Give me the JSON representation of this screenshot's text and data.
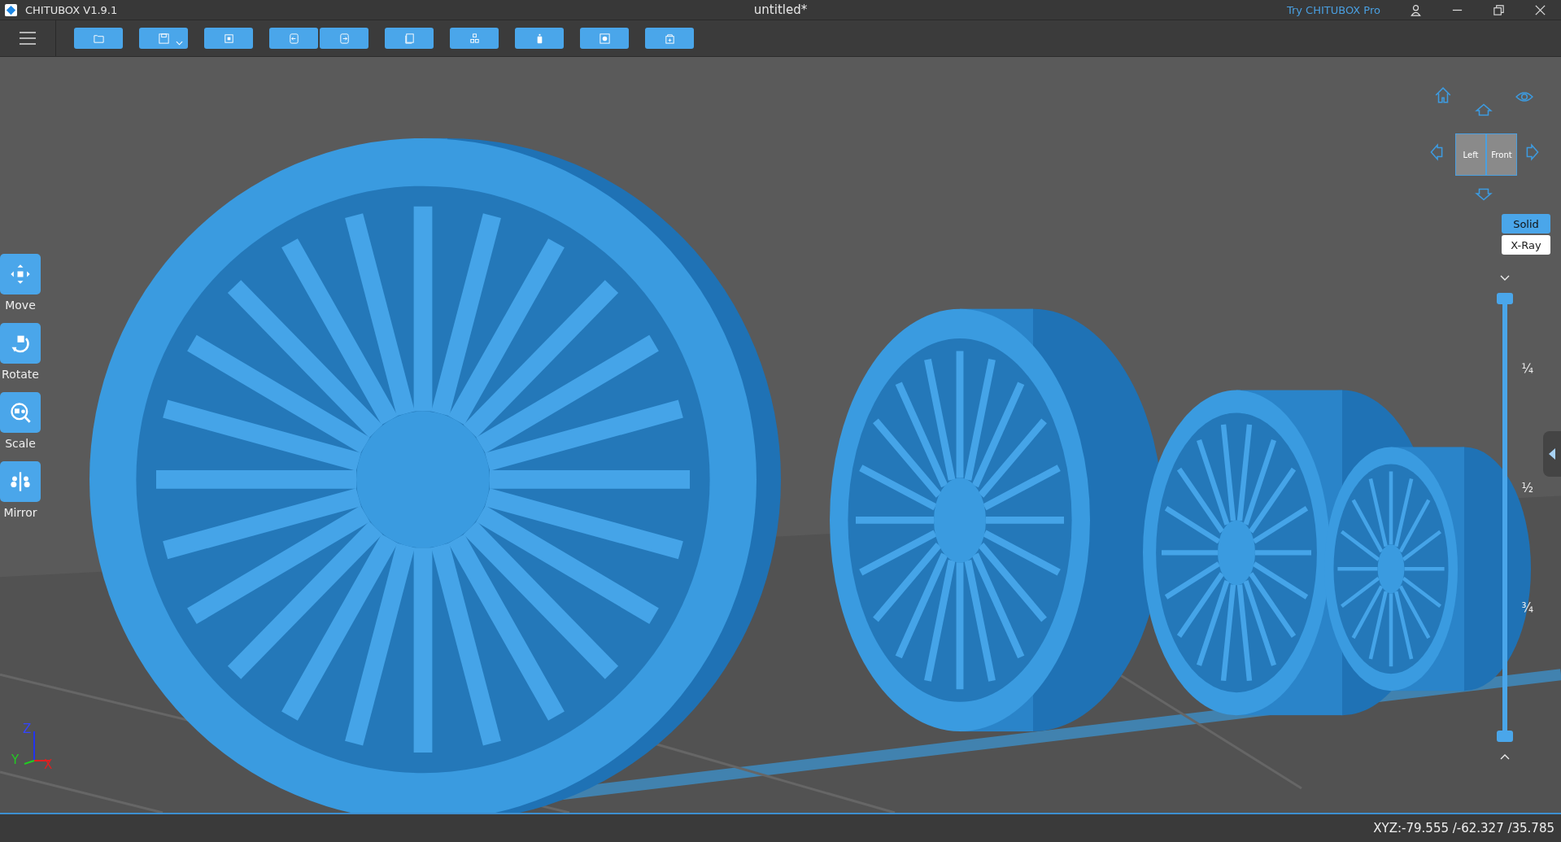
{
  "window": {
    "app_name": "CHITUBOX V1.9.1",
    "title": "untitled*",
    "pro_link": "Try CHITUBOX Pro"
  },
  "tools": [
    {
      "label": "Move"
    },
    {
      "label": "Rotate"
    },
    {
      "label": "Scale"
    },
    {
      "label": "Mirror"
    }
  ],
  "view_cube": {
    "faces": [
      "Left",
      "Front"
    ]
  },
  "view_modes": [
    {
      "label": "Solid",
      "selected": true
    },
    {
      "label": "X-Ray",
      "selected": false
    }
  ],
  "layer_slider": {
    "level": 1,
    "ticks": [
      "¼",
      "½",
      "¾"
    ]
  },
  "axes": {
    "z": "Z",
    "y": "Y",
    "x": "X"
  },
  "status_bar": {
    "coordinates": "XYZ:-79.555 /-62.327 /35.785"
  }
}
